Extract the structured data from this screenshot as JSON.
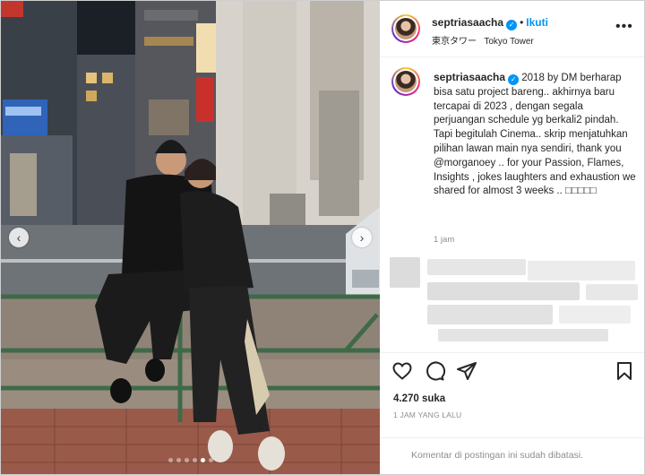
{
  "post": {
    "username": "septriasaacha",
    "follow_label": "Ikuti",
    "separator": "•",
    "location_jp": "東京タワー",
    "location_en": "Tokyo Tower",
    "caption_user": "septriasaacha",
    "caption_text": "2018 by DM berharap bisa satu project bareng.. akhirnya baru tercapai di 2023 , dengan segala perjuangan schedule yg berkali2 pindah. Tapi begitulah Cinema.. skrip menjatuhkan pilihan lawan main nya sendiri, thank you @morganoey .. for your Passion, Flames, Insights , jokes laughters and exhaustion we shared for almost 3 weeks .. ",
    "caption_emoji": "□□□□□",
    "time_ago": "1 jam",
    "likes": "4.270 suka",
    "date_label": "1 JAM YANG LALU",
    "comments_disabled": "Komentar di postingan ini sudah dibatasi."
  },
  "carousel": {
    "slide_count": 6,
    "active_index": 4
  },
  "icons": {
    "more": "more-options-icon",
    "verified": "verified-badge-icon",
    "like": "heart-icon",
    "comment": "comment-icon",
    "share": "share-icon",
    "save": "bookmark-icon",
    "prev": "chevron-left-icon",
    "next": "chevron-right-icon"
  },
  "colors": {
    "accent": "#0095f6",
    "text": "#262626",
    "muted": "#8e8e8e"
  }
}
